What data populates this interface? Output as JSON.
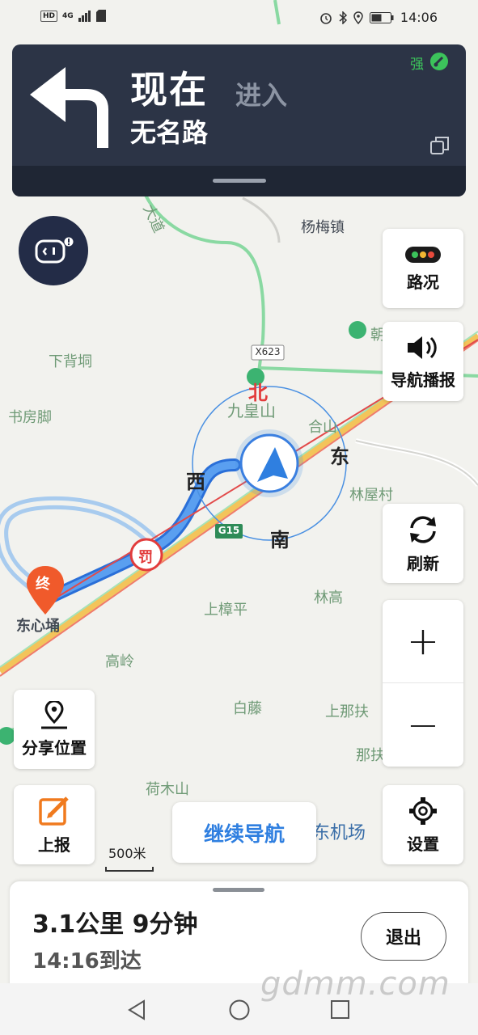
{
  "status_bar": {
    "hd": "HD",
    "network": "4G",
    "time": "14:06"
  },
  "nav_banner": {
    "turn_primary": "现在",
    "turn_secondary": "进入",
    "road_name": "无名路",
    "signal_label": "强",
    "turn_icon": "turn-left-arrow-icon",
    "colors": {
      "banner": "#2c3446",
      "signal": "#3cc35b"
    }
  },
  "map": {
    "places": {
      "yangmei": "杨梅镇",
      "xiabeidong": "下背垌",
      "shufangjiao": "书房脚",
      "jiuhuangshan": "九皇山",
      "heshan": "合山",
      "linwucun": "林屋村",
      "shangzhangping": "上樟平",
      "lingao": "林高",
      "dongxinyong": "东心埇",
      "gaoling": "高岭",
      "baiteng": "白藤",
      "shangnafu": "上那扶",
      "nafu": "那扶",
      "hemushan": "荷木山",
      "airport": "东机场",
      "dadao": "大道",
      "chao": "朝"
    },
    "road_badges": {
      "x623": "X623",
      "g15": "G15"
    },
    "compass": {
      "north": "北",
      "south": "南",
      "east": "东",
      "west": "西"
    },
    "end_marker": "终",
    "camera_marker": "罚",
    "scale_label": "500米",
    "colors": {
      "route": "#3d86ea",
      "alt_route": "#a8cbee",
      "road_green": "#8ad9a2"
    }
  },
  "buttons": {
    "traffic": "路况",
    "voice": "导航播报",
    "refresh": "刷新",
    "zoom_in": "+",
    "zoom_out": "−",
    "share_location": "分享位置",
    "report": "上报",
    "settings": "设置",
    "continue_nav": "继续导航"
  },
  "bottom_panel": {
    "trip_summary": "3.1公里 9分钟",
    "arrival": "14:16到达",
    "exit": "退出"
  },
  "watermark": "gdmm.com"
}
